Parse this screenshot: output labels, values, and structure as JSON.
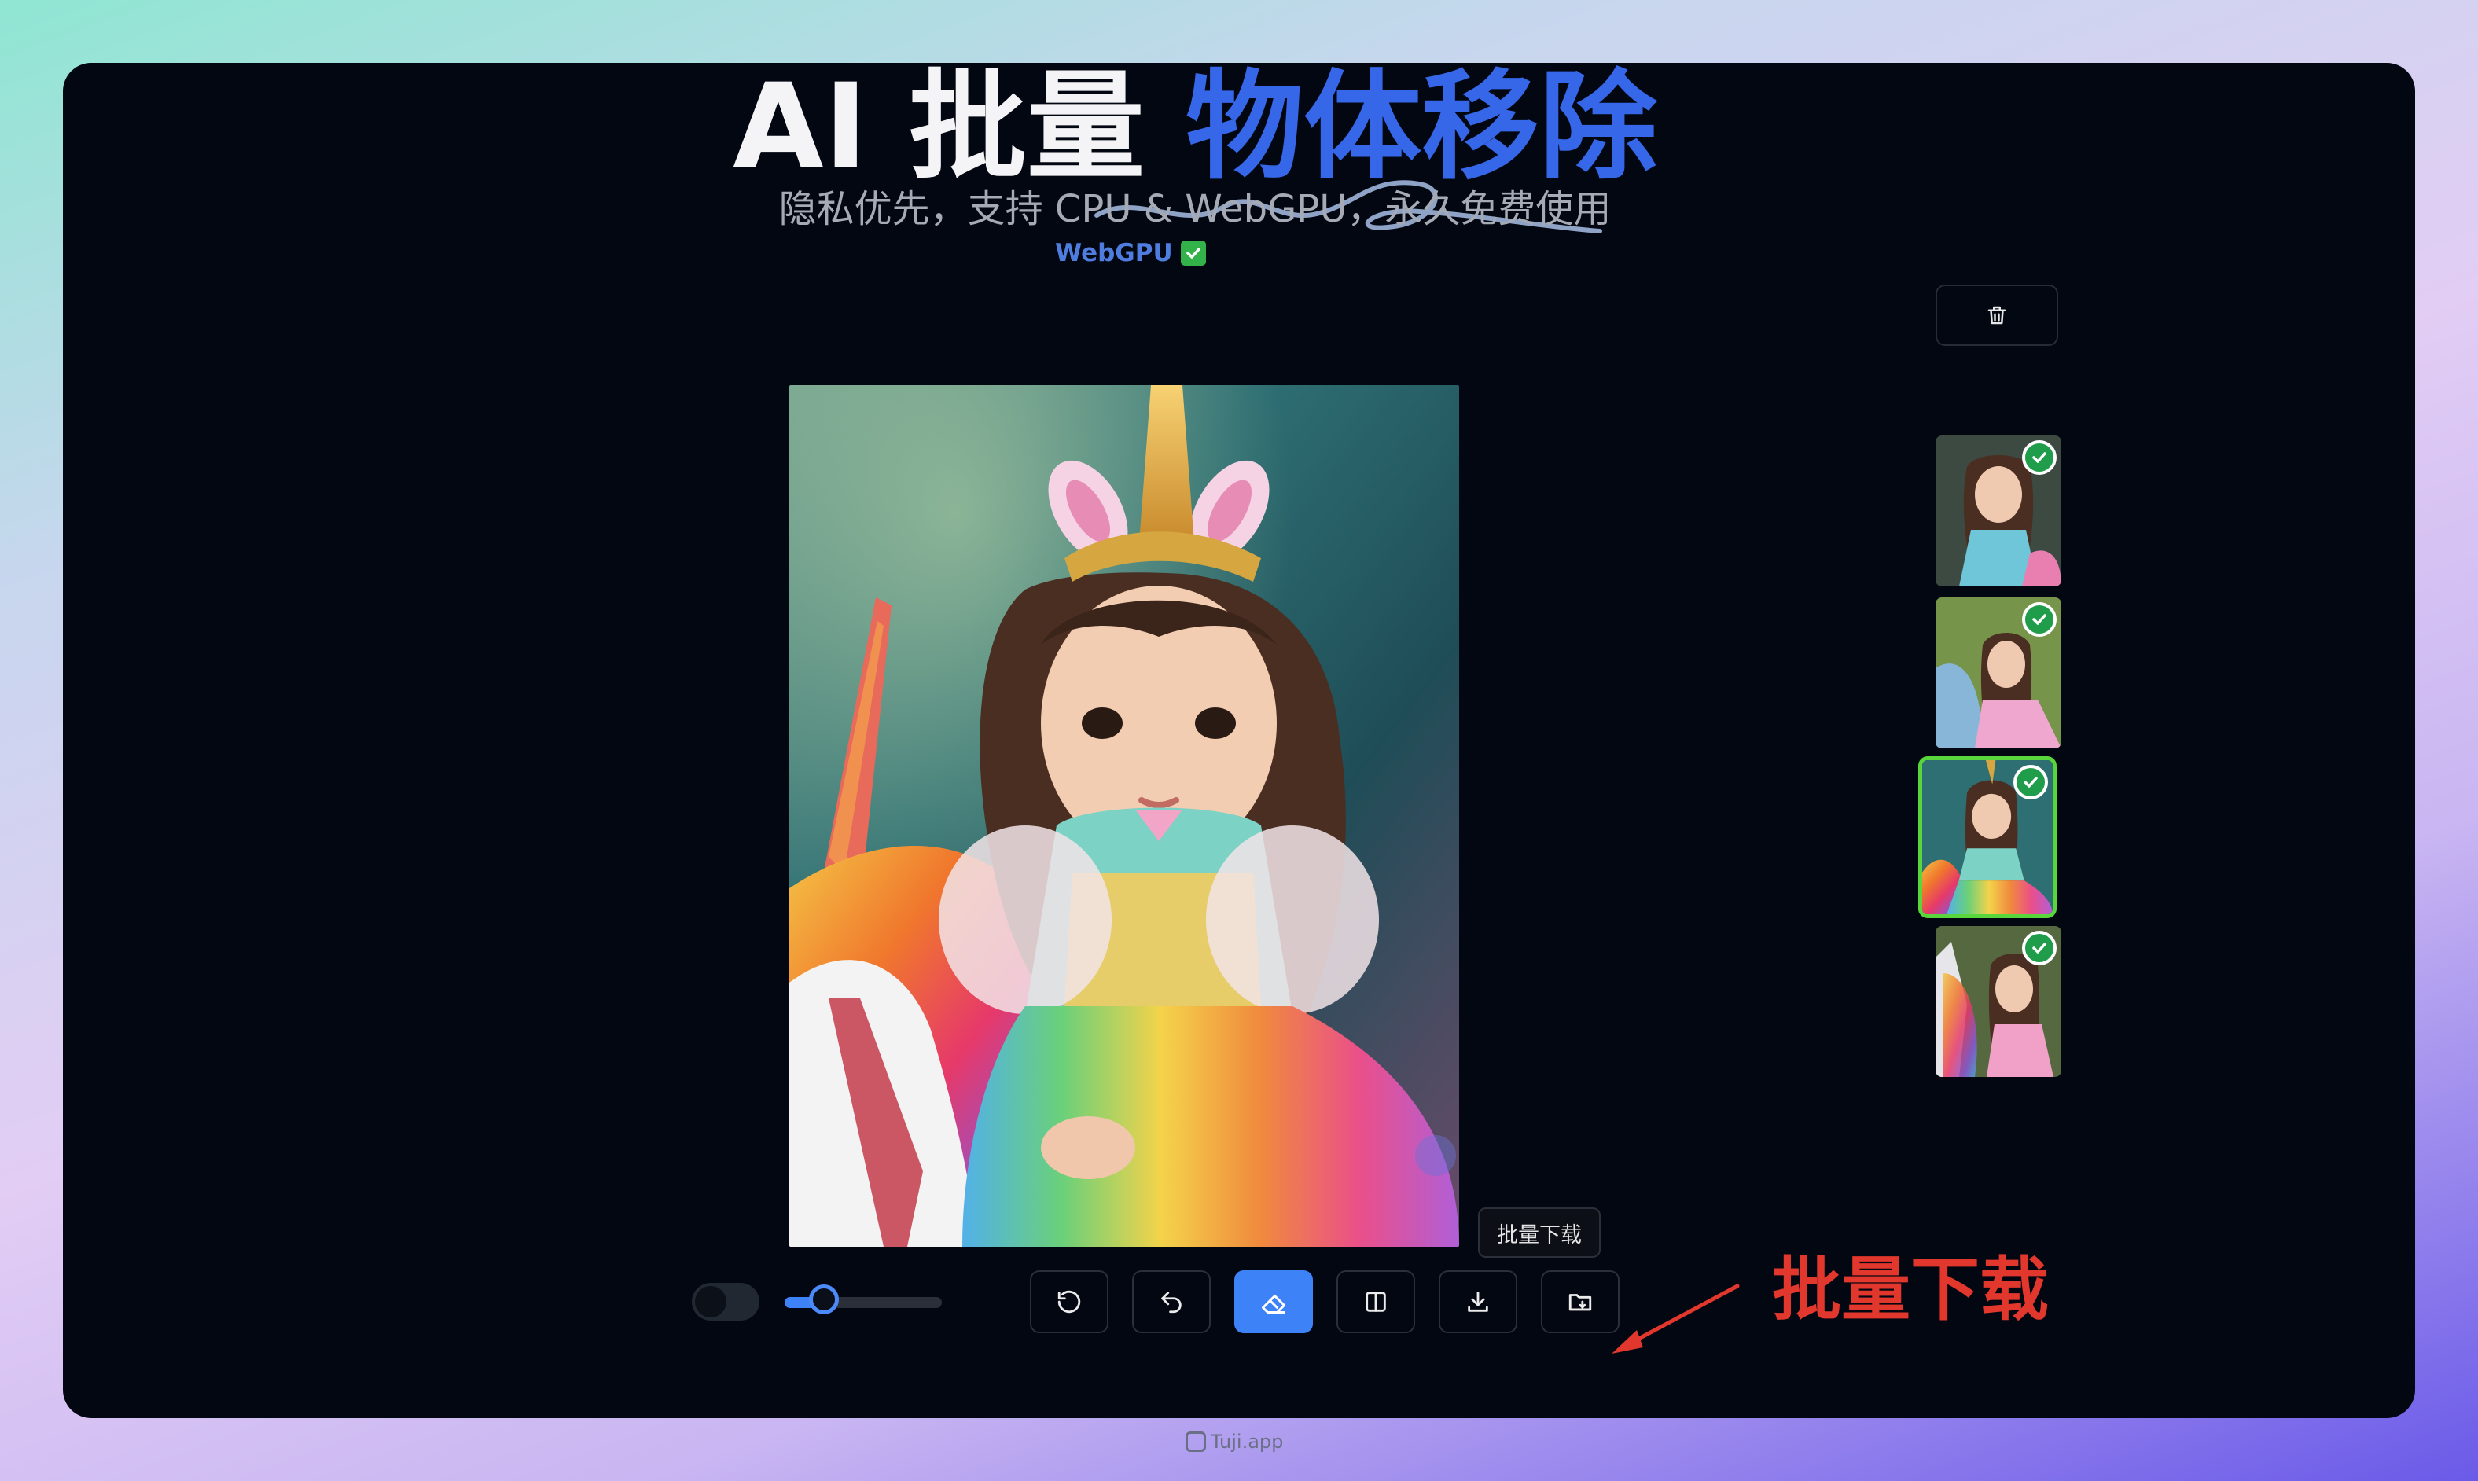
{
  "title": {
    "part1": "AI 批量 ",
    "part2": "物体移除"
  },
  "subtitle": "隐私优先，支持 CPU & WebGPU，永久免费使用",
  "status": {
    "label": "WebGPU",
    "check": "✅"
  },
  "toolbar": {
    "tooltip": "批量下载",
    "slider_value": 0.25,
    "toggle_on": false,
    "buttons": [
      {
        "name": "reset-button",
        "icon": "rotate-ccw-icon"
      },
      {
        "name": "undo-button",
        "icon": "undo-icon"
      },
      {
        "name": "eraser-button",
        "icon": "eraser-icon",
        "active": true
      },
      {
        "name": "compare-button",
        "icon": "split-view-icon"
      },
      {
        "name": "download-button",
        "icon": "download-icon"
      },
      {
        "name": "batch-download-button",
        "icon": "folder-download-icon"
      }
    ]
  },
  "thumbnails": {
    "count": 4,
    "selected_index": 2
  },
  "annotation": "批量下载",
  "footer": "Tuji.app",
  "colors": {
    "accent": "#3e82f7",
    "title_highlight": "#3567e8",
    "selected_border": "#58d63c",
    "annotation": "#e2372c",
    "background": "#030712"
  }
}
